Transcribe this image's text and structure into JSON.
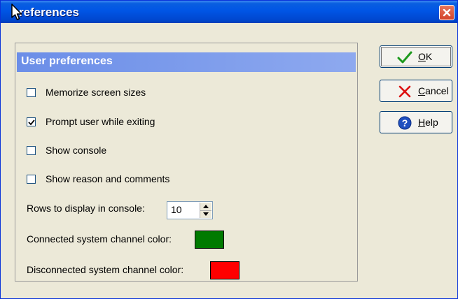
{
  "window": {
    "title": "references"
  },
  "panel": {
    "header": "User preferences",
    "options": [
      {
        "label": "Memorize screen sizes",
        "checked": false
      },
      {
        "label": "Prompt user while exiting",
        "checked": true
      },
      {
        "label": "Show console",
        "checked": false
      },
      {
        "label": "Show reason and comments",
        "checked": false
      }
    ],
    "rows_label": "Rows to display in console:",
    "rows_value": "10",
    "connected_label": "Connected system channel color:",
    "connected_color": "#007a00",
    "disconnected_label": "Disconnected system channel color:",
    "disconnected_color": "#ff0000"
  },
  "buttons": {
    "ok": {
      "mnemonic": "O",
      "rest": "K",
      "icon": "checkmark-icon"
    },
    "cancel": {
      "mnemonic": "C",
      "rest": "ancel",
      "icon": "x-icon"
    },
    "help": {
      "mnemonic": "H",
      "rest": "elp",
      "icon": "question-icon"
    }
  },
  "colors": {
    "titlebar": "#0055e5",
    "panel_header": "#7a9aec"
  }
}
